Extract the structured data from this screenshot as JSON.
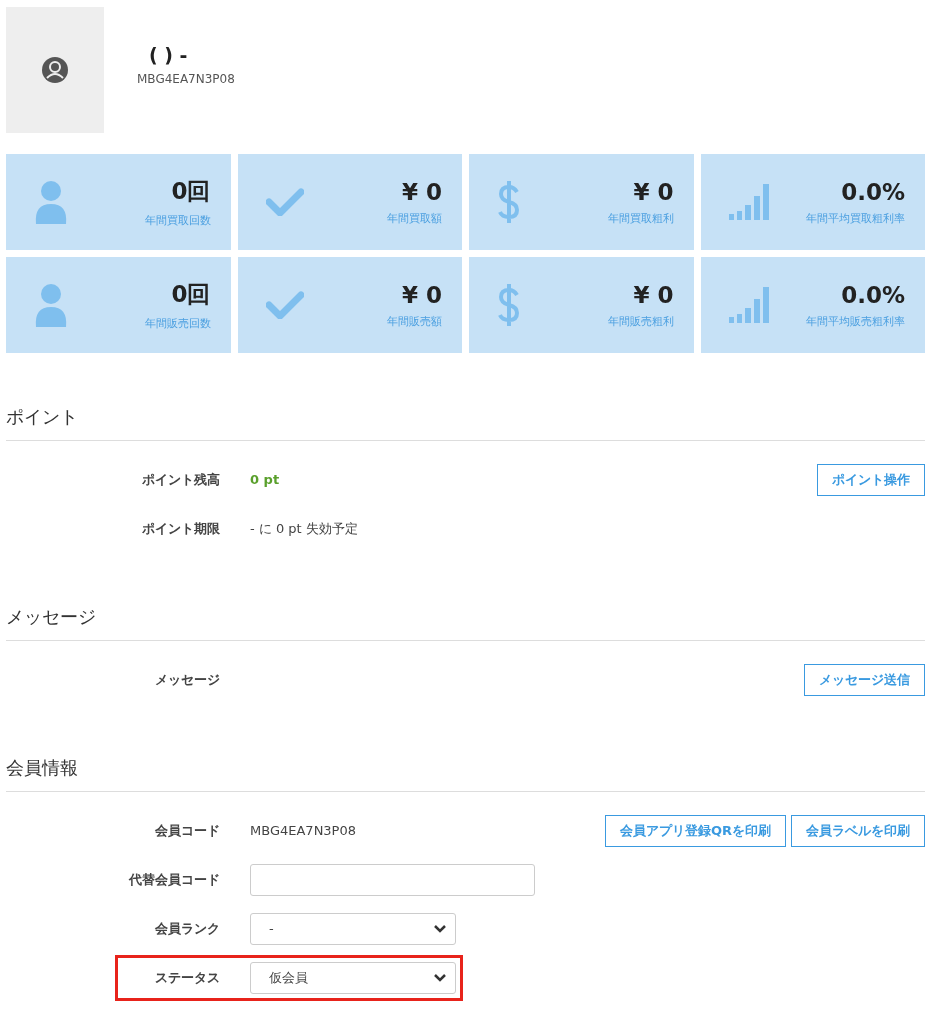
{
  "profile": {
    "name": "( ) -",
    "code": "MBG4EA7N3P08"
  },
  "stats": [
    {
      "kind": "person",
      "value": "0回",
      "label": "年間買取回数"
    },
    {
      "kind": "check",
      "value": "¥ 0",
      "label": "年間買取額"
    },
    {
      "kind": "dollar",
      "value": "¥ 0",
      "label": "年間買取粗利"
    },
    {
      "kind": "bars",
      "value": "0.0%",
      "label": "年間平均買取粗利率"
    },
    {
      "kind": "person",
      "value": "0回",
      "label": "年間販売回数"
    },
    {
      "kind": "check",
      "value": "¥ 0",
      "label": "年間販売額"
    },
    {
      "kind": "dollar",
      "value": "¥ 0",
      "label": "年間販売粗利"
    },
    {
      "kind": "bars",
      "value": "0.0%",
      "label": "年間平均販売粗利率"
    }
  ],
  "sections": [
    {
      "title": "ポイント",
      "rows": [
        {
          "kind": "text",
          "label": "ポイント残高",
          "value": "0 pt",
          "accent": true,
          "buttons": [
            "ポイント操作"
          ]
        },
        {
          "kind": "text",
          "label": "ポイント期限",
          "value": "- に 0 pt 失効予定",
          "accent": false
        }
      ]
    },
    {
      "title": "メッセージ",
      "rows": [
        {
          "kind": "text",
          "label": "メッセージ",
          "buttons": [
            "メッセージ送信"
          ]
        }
      ]
    },
    {
      "title": "会員情報",
      "rows": [
        {
          "kind": "text",
          "label": "会員コード",
          "value": "MBG4EA7N3P08",
          "buttons": [
            "会員アプリ登録QRを印刷",
            "会員ラベルを印刷"
          ]
        },
        {
          "kind": "input",
          "label": "代替会員コード"
        },
        {
          "kind": "select",
          "label": "会員ランク",
          "value": "-"
        },
        {
          "kind": "select",
          "label": "ステータス",
          "value": "仮会員",
          "highlighted": true
        }
      ]
    }
  ]
}
